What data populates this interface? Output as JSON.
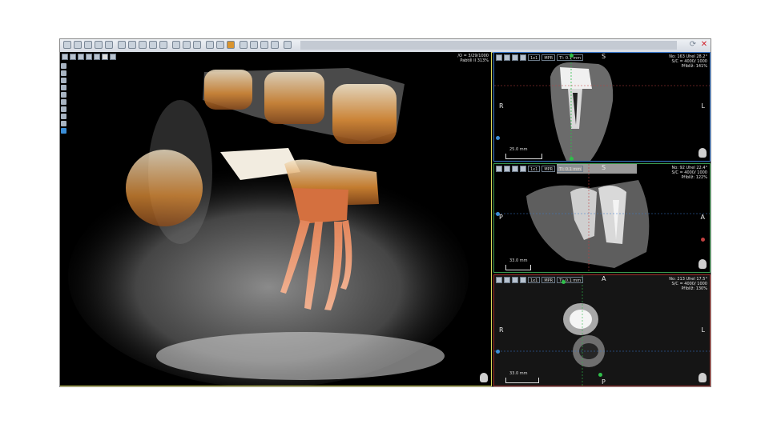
{
  "main_view": {
    "info_line1": "/O = 3/29/1000",
    "info_line2": "Pabtill II 313%"
  },
  "axial_view": {
    "info_line1": "No: 163 Uhel 28.2°",
    "info_line2": "S/C = 4000/ 1000",
    "info_line3": "Přiblíž: 141%",
    "top": "S",
    "left": "R",
    "right": "L",
    "scale_label": "25.0 mm",
    "mpr_label": "MPR",
    "thickness_label": "Tl: 0.1 mm"
  },
  "sagittal_view": {
    "info_line1": "No: 92 Uhel 22.4°",
    "info_line2": "S/C = 4000/ 1000",
    "info_line3": "Přiblíž: 122%",
    "top": "S",
    "left": "P",
    "right": "A",
    "scale_label": "33.0 mm",
    "mpr_label": "MPR",
    "thickness_label": "Tl: 0.1 mm"
  },
  "coronal_view": {
    "info_line1": "No: 213 Uhel 17.5°",
    "info_line2": "S/C = 4000/ 1000",
    "info_line3": "Přiblíž: 130%",
    "top": "A",
    "left": "R",
    "right": "L",
    "bottom": "P",
    "scale_label": "33.0 mm",
    "mpr_label": "MPR",
    "thickness_label": "Tl: 0.1 mm"
  },
  "colors": {
    "axial_border": "#3a7ad0",
    "sagittal_border": "#3a9a50",
    "coronal_border": "#a0302c",
    "main_border": "#d8d85a"
  }
}
